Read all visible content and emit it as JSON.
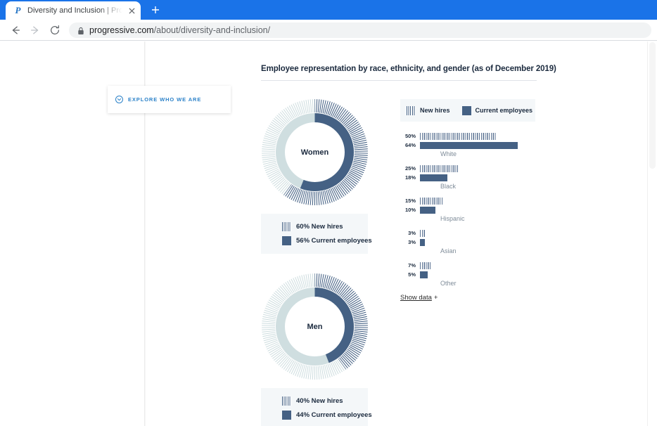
{
  "browser": {
    "tab": {
      "title": "Diversity and Inclusion | Progressive",
      "favicon": "P",
      "close_icon": "close-icon"
    },
    "new_tab_label": "+",
    "back_icon": "back-arrow-icon",
    "forward_icon": "forward-arrow-icon",
    "reload_icon": "reload-icon",
    "lock_icon": "lock-icon",
    "url_domain": "progressive.com",
    "url_path": "/about/diversity-and-inclusion/"
  },
  "page": {
    "explore_card": {
      "label": "EXPLORE WHO WE ARE",
      "icon": "chevron-down-circle-icon"
    },
    "chart_title": "Employee representation by race, ethnicity, and gender (as of December 2019)",
    "show_data_label": "Show data",
    "show_data_plus": "+",
    "legend": {
      "new_hires": "New hires",
      "current_employees": "Current employees"
    },
    "colors": {
      "solid": "#456184",
      "striped": "#5a7292",
      "light_ring": "#cfdee0",
      "panel_bg": "#f4f7f9",
      "accent_blue": "#2c82c9",
      "browser_blue": "#1a73e8"
    }
  },
  "chart_data": [
    {
      "type": "pie",
      "title": "Women",
      "legend_position": "below",
      "series": [
        {
          "name": "New hires",
          "value": 60,
          "label": "60% New hires",
          "style": "striped"
        },
        {
          "name": "Current employees",
          "value": 56,
          "label": "56% Current employees",
          "style": "solid"
        }
      ]
    },
    {
      "type": "pie",
      "title": "Men",
      "legend_position": "below",
      "series": [
        {
          "name": "New hires",
          "value": 40,
          "label": "40% New hires",
          "style": "striped"
        },
        {
          "name": "Current employees",
          "value": 44,
          "label": "44% Current employees",
          "style": "solid"
        }
      ]
    },
    {
      "type": "bar",
      "title": "Employee representation by race, ethnicity, and gender (as of December 2019)",
      "orientation": "horizontal",
      "categories": [
        "White",
        "Black",
        "Hispanic",
        "Asian",
        "Other"
      ],
      "xlabel": "",
      "ylabel": "",
      "xlim": [
        0,
        70
      ],
      "grid": false,
      "series": [
        {
          "name": "New hires",
          "style": "striped",
          "values": [
            50,
            25,
            15,
            3,
            7
          ],
          "labels": [
            "50%",
            "25%",
            "15%",
            "3%",
            "7%"
          ]
        },
        {
          "name": "Current employees",
          "style": "solid",
          "values": [
            64,
            18,
            10,
            3,
            5
          ],
          "labels": [
            "64%",
            "18%",
            "10%",
            "3%",
            "5%"
          ]
        }
      ]
    }
  ]
}
